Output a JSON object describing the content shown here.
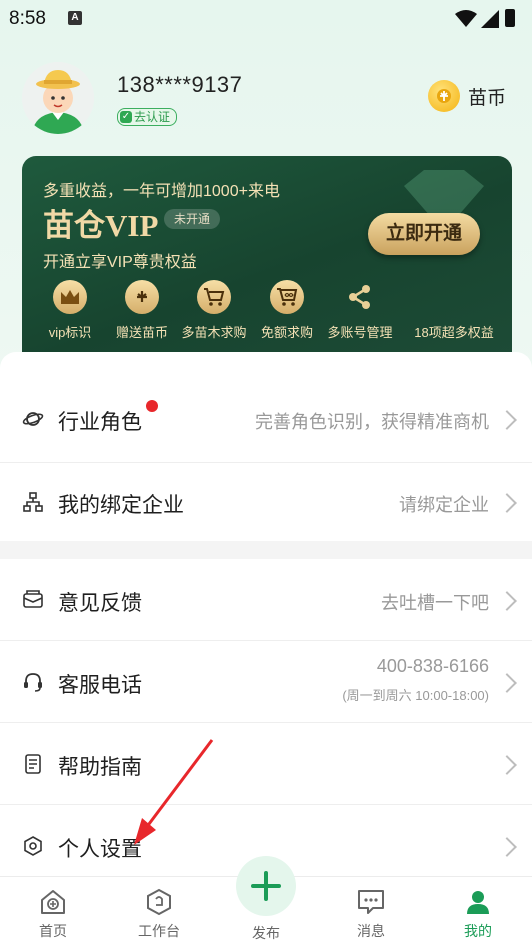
{
  "status": {
    "time": "8:58",
    "notif_icon": "A"
  },
  "profile": {
    "phone": "138****9137",
    "verify_badge": "去认证",
    "coins_label": "苗币"
  },
  "vip": {
    "line1": "多重收益，一年可增加1000+来电",
    "title": "苗仓VIP",
    "status_tag": "未开通",
    "subtitle": "开通立享VIP尊贵权益",
    "button": "立即开通",
    "perks": [
      {
        "label": "vip标识",
        "icon": "crown-icon"
      },
      {
        "label": "赠送苗币",
        "icon": "coin-icon"
      },
      {
        "label": "多苗木求购",
        "icon": "cart-icon"
      },
      {
        "label": "免额求购",
        "icon": "cart-infinite-icon"
      },
      {
        "label": "多账号管理",
        "icon": "share-icon"
      },
      {
        "label": "18项超多权益",
        "icon": ""
      }
    ]
  },
  "menu": {
    "role": {
      "label": "行业角色",
      "value": "完善角色识别，获得精准商机"
    },
    "company": {
      "label": "我的绑定企业",
      "value": "请绑定企业"
    },
    "feedback": {
      "label": "意见反馈",
      "value": "去吐槽一下吧"
    },
    "service": {
      "label": "客服电话",
      "value": "400-838-6166",
      "hours": "(周一到周六 10:00-18:00)"
    },
    "guide": {
      "label": "帮助指南"
    },
    "settings": {
      "label": "个人设置"
    }
  },
  "tabs": {
    "home": "首页",
    "workbench": "工作台",
    "publish": "发布",
    "messages": "消息",
    "mine": "我的"
  },
  "colors": {
    "brand_green": "#1b9c57",
    "vip_dark": "#17442f",
    "gold": "#f1d9a6",
    "annotation_red": "#e8272b"
  }
}
